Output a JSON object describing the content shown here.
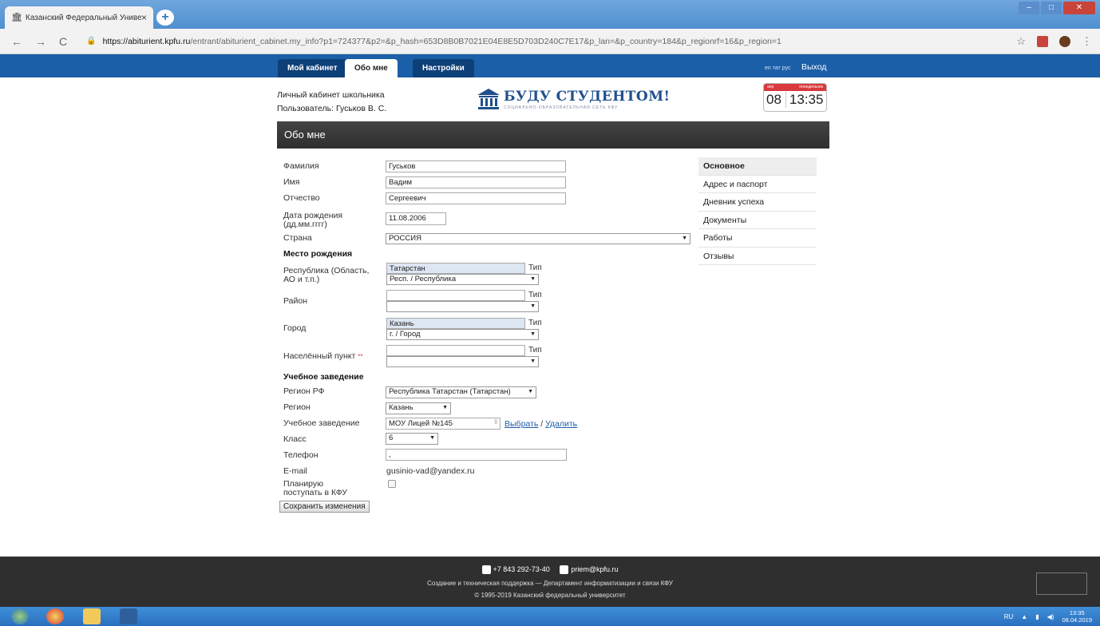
{
  "browser": {
    "tab_title": "Казанский Федеральный Униве",
    "tab_close": "×",
    "new_tab": "+",
    "url_host": "https://abiturient.kpfu.ru",
    "url_path": "/entrant/abiturient_cabinet.my_info?p1=724377&p2=&p_hash=653D8B0B7021E04E8E5D703D240C7E17&p_lan=&p_country=184&p_regionrf=16&p_region=1",
    "back": "←",
    "forward": "→",
    "reload": "C",
    "star": "☆"
  },
  "nav": {
    "tabs": [
      "Мой кабинет",
      "Обо мне",
      "Настройки"
    ],
    "langs": "en тат рус",
    "exit": "Выход"
  },
  "cabinet": {
    "line1": "Личный кабинет школьника",
    "line2": "Пользователь: Гуськов В. С."
  },
  "logo": {
    "name": "БУДУ СТУДЕНТОМ!",
    "sub": "СОЦИАЛЬНО-ОБРАЗОВАТЕЛЬНАЯ СЕТЬ КФУ"
  },
  "clock": {
    "month": "апр",
    "weekday": "понедельник",
    "day": "08",
    "time": "13:35"
  },
  "page_title": "Обо мне",
  "form": {
    "surname_label": "Фамилия",
    "surname": "Гуськов",
    "name_label": "Имя",
    "name": "Вадим",
    "patronymic_label": "Отчество",
    "patronymic": "Сергеевич",
    "birthdate_label": "Дата рождения (дд.мм.гггг)",
    "birthdate": "11.08.2006",
    "country_label": "Страна",
    "country": "РОССИЯ",
    "birthplace_section": "Место рождения",
    "republic_label": "Республика (Область, АО и т.п.)",
    "republic": "Татарстан",
    "republic_type": "Респ. / Республика",
    "district_label": "Район",
    "district": "",
    "district_type": "",
    "city_label": "Город",
    "city": "Казань",
    "city_type": "г. / Город",
    "locality_label": "Населённый пункт",
    "locality_req": "**",
    "locality": "",
    "locality_type": "",
    "type_label": "Тип",
    "school_section": "Учебное заведение",
    "region_rf_label": "Регион РФ",
    "region_rf": "Республика Татарстан (Татарстан)",
    "region_label": "Регион",
    "region": "Казань",
    "school_label": "Учебное заведение",
    "school": "МОУ Лицей №145",
    "choose": "Выбрать",
    "slash": " / ",
    "delete": "Удалить",
    "class_label": "Класс",
    "class": "6",
    "phone_label": "Телефон",
    "phone": ",",
    "email_label": "E-mail",
    "email": "gusinio-vad@yandex.ru",
    "plan_label": "Планирую поступать в КФУ",
    "save": "Сохранить изменения"
  },
  "menu": [
    "Основное",
    "Адрес и паспорт",
    "Дневник успеха",
    "Документы",
    "Работы",
    "Отзывы"
  ],
  "footer": {
    "phone": "+7 843 292-73-40",
    "email": "priem@kpfu.ru",
    "support": "Создание и техническая поддержка — Департамент информатизации и связи КФУ",
    "copyright": "© 1995-2019 Казанский федеральный университет"
  },
  "taskbar": {
    "lang": "RU",
    "time": "13:35",
    "date": "08.04.2019"
  }
}
